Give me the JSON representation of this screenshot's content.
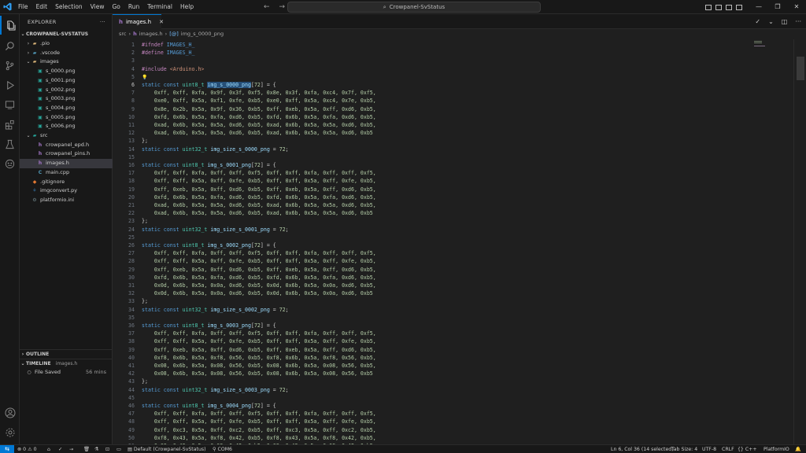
{
  "titlebar": {
    "menus": [
      "File",
      "Edit",
      "Selection",
      "View",
      "Go",
      "Run",
      "Terminal",
      "Help"
    ],
    "search": "Crowpanel-SvStatus",
    "back_icon": "arrow-left-icon",
    "forward_icon": "arrow-right-icon"
  },
  "sidebar": {
    "title": "EXPLORER",
    "more": "···",
    "project": "CROWPANEL-SVSTATUS",
    "items": [
      {
        "label": ".pio",
        "type": "folder",
        "indent": 1,
        "chev": "›"
      },
      {
        "label": ".vscode",
        "type": "folder-vs",
        "indent": 1,
        "chev": "›"
      },
      {
        "label": "images",
        "type": "folder",
        "indent": 1,
        "chev": "⌄"
      },
      {
        "label": "s_0000.png",
        "type": "png",
        "indent": 2
      },
      {
        "label": "s_0001.png",
        "type": "png",
        "indent": 2
      },
      {
        "label": "s_0002.png",
        "type": "png",
        "indent": 2
      },
      {
        "label": "s_0003.png",
        "type": "png",
        "indent": 2
      },
      {
        "label": "s_0004.png",
        "type": "png",
        "indent": 2
      },
      {
        "label": "s_0005.png",
        "type": "png",
        "indent": 2
      },
      {
        "label": "s_0006.png",
        "type": "png",
        "indent": 2
      },
      {
        "label": "src",
        "type": "folder-src",
        "indent": 1,
        "chev": "⌄"
      },
      {
        "label": "crowpanel_epd.h",
        "type": "h",
        "indent": 2
      },
      {
        "label": "crowpanel_pins.h",
        "type": "h",
        "indent": 2
      },
      {
        "label": "images.h",
        "type": "h",
        "indent": 2,
        "selected": true
      },
      {
        "label": "main.cpp",
        "type": "cpp",
        "indent": 2
      },
      {
        "label": ".gitignore",
        "type": "git",
        "indent": 1
      },
      {
        "label": "imgconvert.py",
        "type": "py",
        "indent": 1
      },
      {
        "label": "platformio.ini",
        "type": "ini",
        "indent": 1
      }
    ],
    "outline": "OUTLINE",
    "timeline": "TIMELINE",
    "timeline_file": "images.h",
    "timeline_entry": "File Saved",
    "timeline_time": "56 mins"
  },
  "editor": {
    "tab_label": "images.h",
    "breadcrumb": [
      "src",
      "images.h",
      "img_s_0000_png"
    ],
    "lines": [
      [
        [
          "#ifndef ",
          "dir"
        ],
        [
          "IMAGES_H_",
          "macro"
        ]
      ],
      [
        [
          "#define ",
          "dir"
        ],
        [
          "IMAGES_H_",
          "macro"
        ]
      ],
      [],
      [
        [
          "#include ",
          "dir"
        ],
        [
          "<Arduino.h>",
          "str"
        ]
      ],
      [
        [
          "💡",
          "bulb"
        ]
      ],
      [
        [
          "static ",
          "kw"
        ],
        [
          "const ",
          "kw"
        ],
        [
          "uint8_t ",
          "type"
        ],
        [
          "img_s_0000_png",
          "varsel"
        ],
        [
          "[",
          "p"
        ],
        [
          "72",
          "num"
        ],
        [
          "] = {",
          "p"
        ]
      ],
      [
        [
          "    0xff, 0xff, 0xfa, 0x9f, 0x3f, 0xf5, 0x8e, 0x3f, 0xfa, 0xc4, 0x7f, 0xf5,",
          "num"
        ]
      ],
      [
        [
          "    0xe0, 0xff, 0x5a, 0xf1, 0xfe, 0xb5, 0xe0, 0xff, 0x5a, 0xc4, 0x7e, 0xb5,",
          "num"
        ]
      ],
      [
        [
          "    0x8e, 0x2b, 0x5a, 0x9f, 0x36, 0xb5, 0xff, 0xeb, 0x5a, 0xff, 0xd6, 0xb5,",
          "num"
        ]
      ],
      [
        [
          "    0xfd, 0x6b, 0x5a, 0xfa, 0xd6, 0xb5, 0xfd, 0x6b, 0x5a, 0xfa, 0xd6, 0xb5,",
          "num"
        ]
      ],
      [
        [
          "    0xad, 0x6b, 0x5a, 0x5a, 0xd6, 0xb5, 0xad, 0x6b, 0x5a, 0x5a, 0xd6, 0xb5,",
          "num"
        ]
      ],
      [
        [
          "    0xad, 0x6b, 0x5a, 0x5a, 0xd6, 0xb5, 0xad, 0x6b, 0x5a, 0x5a, 0xd6, 0xb5",
          "num"
        ]
      ],
      [
        [
          "};",
          "p"
        ]
      ],
      [
        [
          "static ",
          "kw"
        ],
        [
          "const ",
          "kw"
        ],
        [
          "uint32_t ",
          "type"
        ],
        [
          "img_size_s_0000_png",
          "var"
        ],
        [
          " = ",
          "p"
        ],
        [
          "72",
          "num"
        ],
        [
          ";",
          "p"
        ]
      ],
      [],
      [
        [
          "static ",
          "kw"
        ],
        [
          "const ",
          "kw"
        ],
        [
          "uint8_t ",
          "type"
        ],
        [
          "img_s_0001_png",
          "var"
        ],
        [
          "[",
          "p"
        ],
        [
          "72",
          "num"
        ],
        [
          "] = {",
          "p"
        ]
      ],
      [
        [
          "    0xff, 0xff, 0xfa, 0xff, 0xff, 0xf5, 0xff, 0xff, 0xfa, 0xff, 0xff, 0xf5,",
          "num"
        ]
      ],
      [
        [
          "    0xff, 0xff, 0x5a, 0xff, 0xfe, 0xb5, 0xff, 0xff, 0x5a, 0xff, 0xfe, 0xb5,",
          "num"
        ]
      ],
      [
        [
          "    0xff, 0xeb, 0x5a, 0xff, 0xd6, 0xb5, 0xff, 0xeb, 0x5a, 0xff, 0xd6, 0xb5,",
          "num"
        ]
      ],
      [
        [
          "    0xfd, 0x6b, 0x5a, 0xfa, 0xd6, 0xb5, 0xfd, 0x6b, 0x5a, 0xfa, 0xd6, 0xb5,",
          "num"
        ]
      ],
      [
        [
          "    0xad, 0x6b, 0x5a, 0x5a, 0xd6, 0xb5, 0xad, 0x6b, 0x5a, 0x5a, 0xd6, 0xb5,",
          "num"
        ]
      ],
      [
        [
          "    0xad, 0x6b, 0x5a, 0x5a, 0xd6, 0xb5, 0xad, 0x6b, 0x5a, 0x5a, 0xd6, 0xb5",
          "num"
        ]
      ],
      [
        [
          "};",
          "p"
        ]
      ],
      [
        [
          "static ",
          "kw"
        ],
        [
          "const ",
          "kw"
        ],
        [
          "uint32_t ",
          "type"
        ],
        [
          "img_size_s_0001_png",
          "var"
        ],
        [
          " = ",
          "p"
        ],
        [
          "72",
          "num"
        ],
        [
          ";",
          "p"
        ]
      ],
      [],
      [
        [
          "static ",
          "kw"
        ],
        [
          "const ",
          "kw"
        ],
        [
          "uint8_t ",
          "type"
        ],
        [
          "img_s_0002_png",
          "var"
        ],
        [
          "[",
          "p"
        ],
        [
          "72",
          "num"
        ],
        [
          "] = {",
          "p"
        ]
      ],
      [
        [
          "    0xff, 0xff, 0xfa, 0xff, 0xff, 0xf5, 0xff, 0xff, 0xfa, 0xff, 0xff, 0xf5,",
          "num"
        ]
      ],
      [
        [
          "    0xff, 0xff, 0x5a, 0xff, 0xfe, 0xb5, 0xff, 0xff, 0x5a, 0xff, 0xfe, 0xb5,",
          "num"
        ]
      ],
      [
        [
          "    0xff, 0xeb, 0x5a, 0xff, 0xd6, 0xb5, 0xff, 0xeb, 0x5a, 0xff, 0xd6, 0xb5,",
          "num"
        ]
      ],
      [
        [
          "    0xfd, 0x6b, 0x5a, 0xfa, 0xd6, 0xb5, 0xfd, 0x6b, 0x5a, 0xfa, 0xd6, 0xb5,",
          "num"
        ]
      ],
      [
        [
          "    0x0d, 0x6b, 0x5a, 0x0a, 0xd6, 0xb5, 0x0d, 0x6b, 0x5a, 0x0a, 0xd6, 0xb5,",
          "num"
        ]
      ],
      [
        [
          "    0x0d, 0x6b, 0x5a, 0x0a, 0xd6, 0xb5, 0x0d, 0x6b, 0x5a, 0x0a, 0xd6, 0xb5",
          "num"
        ]
      ],
      [
        [
          "};",
          "p"
        ]
      ],
      [
        [
          "static ",
          "kw"
        ],
        [
          "const ",
          "kw"
        ],
        [
          "uint32_t ",
          "type"
        ],
        [
          "img_size_s_0002_png",
          "var"
        ],
        [
          " = ",
          "p"
        ],
        [
          "72",
          "num"
        ],
        [
          ";",
          "p"
        ]
      ],
      [],
      [
        [
          "static ",
          "kw"
        ],
        [
          "const ",
          "kw"
        ],
        [
          "uint8_t ",
          "type"
        ],
        [
          "img_s_0003_png",
          "var"
        ],
        [
          "[",
          "p"
        ],
        [
          "72",
          "num"
        ],
        [
          "] = {",
          "p"
        ]
      ],
      [
        [
          "    0xff, 0xff, 0xfa, 0xff, 0xff, 0xf5, 0xff, 0xff, 0xfa, 0xff, 0xff, 0xf5,",
          "num"
        ]
      ],
      [
        [
          "    0xff, 0xff, 0x5a, 0xff, 0xfe, 0xb5, 0xff, 0xff, 0x5a, 0xff, 0xfe, 0xb5,",
          "num"
        ]
      ],
      [
        [
          "    0xff, 0xeb, 0x5a, 0xff, 0xd6, 0xb5, 0xff, 0xeb, 0x5a, 0xff, 0xd6, 0xb5,",
          "num"
        ]
      ],
      [
        [
          "    0xf8, 0x6b, 0x5a, 0xf8, 0x56, 0xb5, 0xf8, 0x6b, 0x5a, 0xf8, 0x56, 0xb5,",
          "num"
        ]
      ],
      [
        [
          "    0x08, 0x6b, 0x5a, 0x08, 0x56, 0xb5, 0x08, 0x6b, 0x5a, 0x08, 0x56, 0xb5,",
          "num"
        ]
      ],
      [
        [
          "    0x08, 0x6b, 0x5a, 0x08, 0x56, 0xb5, 0x08, 0x6b, 0x5a, 0x08, 0x56, 0xb5",
          "num"
        ]
      ],
      [
        [
          "};",
          "p"
        ]
      ],
      [
        [
          "static ",
          "kw"
        ],
        [
          "const ",
          "kw"
        ],
        [
          "uint32_t ",
          "type"
        ],
        [
          "img_size_s_0003_png",
          "var"
        ],
        [
          " = ",
          "p"
        ],
        [
          "72",
          "num"
        ],
        [
          ";",
          "p"
        ]
      ],
      [],
      [
        [
          "static ",
          "kw"
        ],
        [
          "const ",
          "kw"
        ],
        [
          "uint8_t ",
          "type"
        ],
        [
          "img_s_0004_png",
          "var"
        ],
        [
          "[",
          "p"
        ],
        [
          "72",
          "num"
        ],
        [
          "] = {",
          "p"
        ]
      ],
      [
        [
          "    0xff, 0xff, 0xfa, 0xff, 0xff, 0xf5, 0xff, 0xff, 0xfa, 0xff, 0xff, 0xf5,",
          "num"
        ]
      ],
      [
        [
          "    0xff, 0xff, 0x5a, 0xff, 0xfe, 0xb5, 0xff, 0xff, 0x5a, 0xff, 0xfe, 0xb5,",
          "num"
        ]
      ],
      [
        [
          "    0xff, 0xc3, 0x5a, 0xff, 0xc2, 0xb5, 0xff, 0xc3, 0x5a, 0xff, 0xc2, 0xb5,",
          "num"
        ]
      ],
      [
        [
          "    0xf8, 0x43, 0x5a, 0xf8, 0x42, 0xb5, 0xf8, 0x43, 0x5a, 0xf8, 0x42, 0xb5,",
          "num"
        ]
      ],
      [
        [
          "    0x08, 0x43, 0x5a, 0x08, 0x42, 0xb5, 0x08, 0x43, 0x5a, 0x08, 0x42, 0xb5,",
          "num"
        ]
      ]
    ],
    "current_line": 6
  },
  "statusbar": {
    "errors": "0",
    "warnings": "0",
    "ports": "0",
    "env": "Default (Crowpanel-SvStatus)",
    "com": "COM6",
    "position": "Ln 6, Col 36 (14 selected)",
    "tab_size": "Tab Size: 4",
    "encoding": "UTF-8",
    "eol": "CRLF",
    "language": "C++",
    "platform": "PlatformIO"
  },
  "colors": {
    "accent": "#0078d4",
    "keyword": "#569cd6",
    "type": "#4ec9b0",
    "variable": "#9cdcfe",
    "number": "#b5cea8",
    "directive": "#c586c0",
    "string": "#ce9178"
  }
}
